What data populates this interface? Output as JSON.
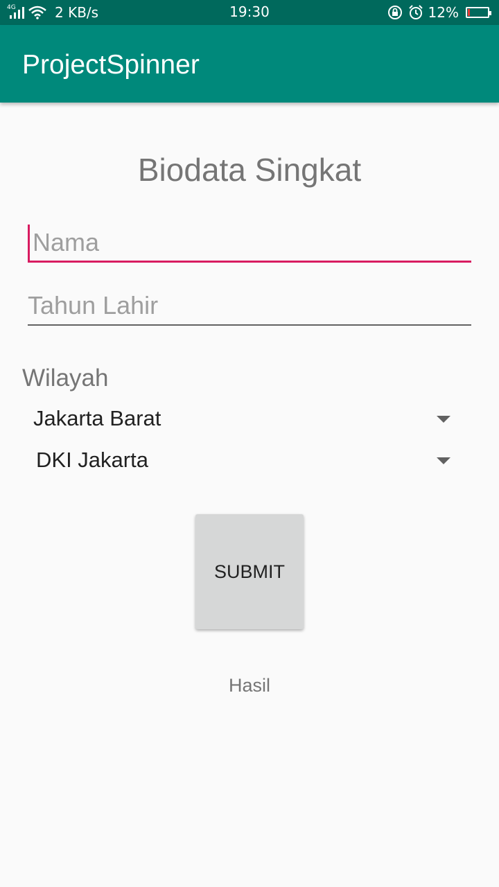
{
  "status_bar": {
    "network": "4G",
    "speed": "2 KB/s",
    "time": "19:30",
    "battery": "12%",
    "battery_level": 0.12,
    "icons": [
      "signal-icon",
      "wifi-icon",
      "rotation-lock-icon",
      "alarm-icon",
      "battery-icon"
    ]
  },
  "app_bar": {
    "title": "ProjectSpinner"
  },
  "form": {
    "title": "Biodata Singkat",
    "nama_placeholder": "Nama",
    "nama_value": "",
    "tahun_placeholder": "Tahun Lahir",
    "tahun_value": "",
    "wilayah_label": "Wilayah",
    "spinner_kota": "Jakarta Barat",
    "spinner_provinsi": "DKI Jakarta",
    "submit_label": "SUBMIT",
    "result": "Hasil"
  },
  "colors": {
    "primary": "#00897b",
    "primary_dark": "#00695c",
    "accent": "#d81b60"
  }
}
